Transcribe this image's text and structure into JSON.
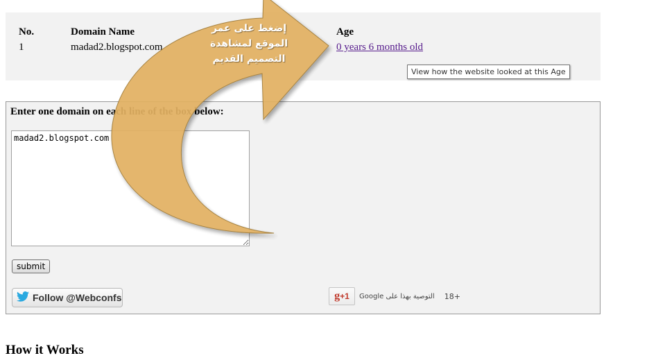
{
  "results": {
    "headers": {
      "no": "No.",
      "domain": "Domain Name",
      "age": "Age"
    },
    "rows": [
      {
        "no": "1",
        "domain": "madad2.blogspot.com",
        "age": "0 years 6 months old"
      }
    ],
    "tooltip": "View how the website looked at this Age"
  },
  "form": {
    "instruction": "Enter one domain on each line of the box below:",
    "textarea_value": "madad2.blogspot.com",
    "submit_label": "submit"
  },
  "social": {
    "follow_label": "Follow @Webconfs",
    "gplus_label": "+1",
    "gplus_recommend": "التوصية بهذا على Google",
    "gplus_count": "18+"
  },
  "how_title": "How it Works",
  "annotation": {
    "text": "إضغط على عمر الموقع لمشاهدة التصميم القديم",
    "color": "#e2b162"
  },
  "colors": {
    "link": "#551a8b",
    "panel": "#f2f2f2",
    "twitter": "#2aa9e0",
    "gplus": "#c0392b"
  }
}
